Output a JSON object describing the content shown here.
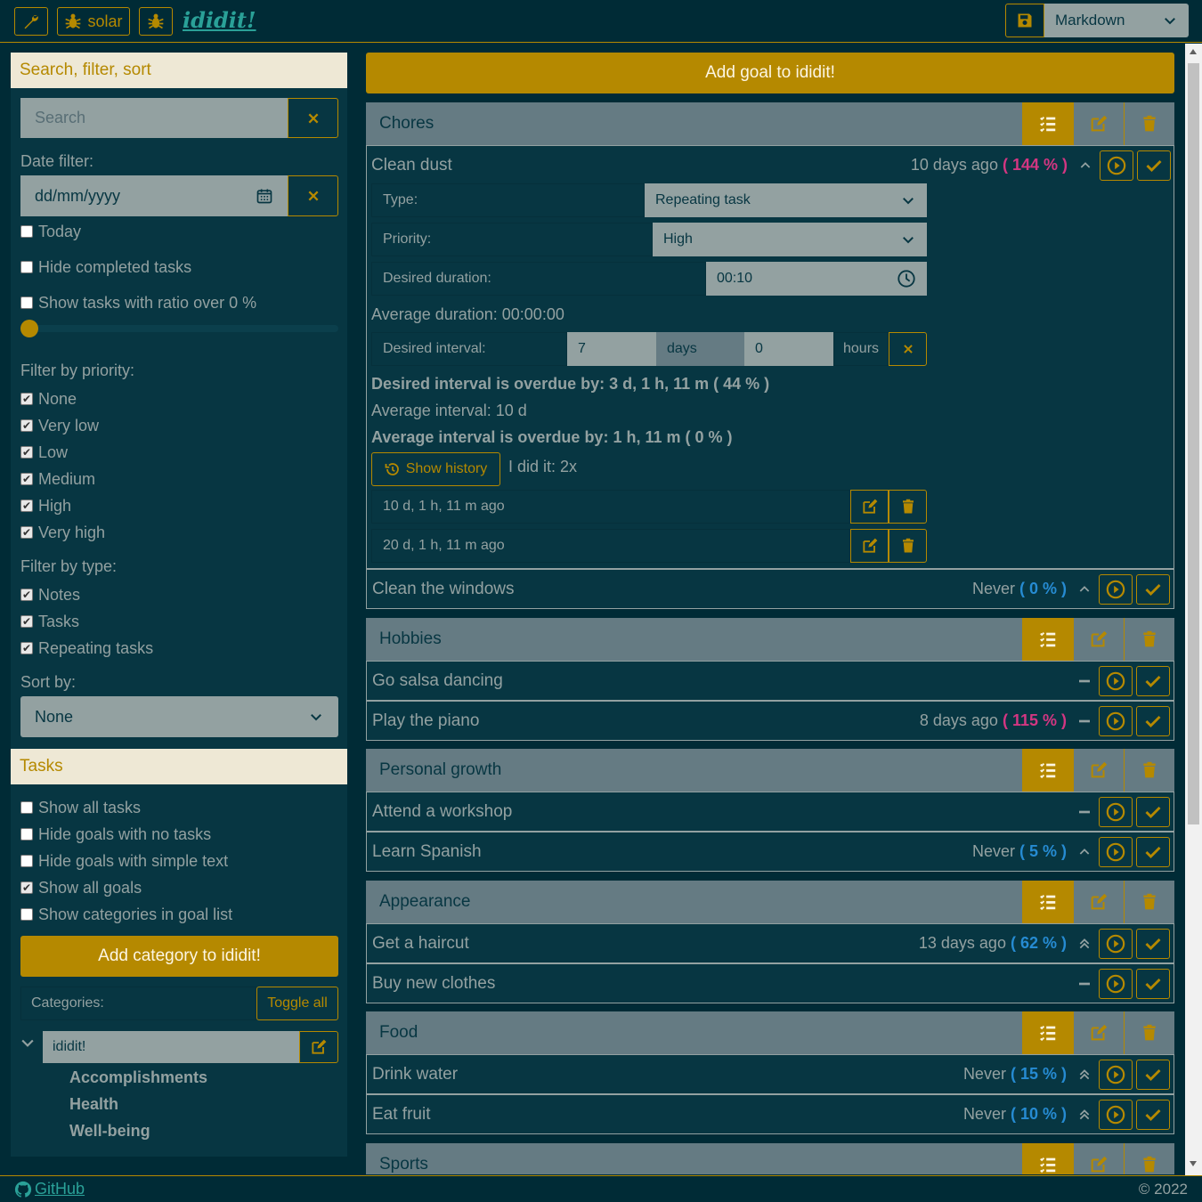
{
  "topbar": {
    "solar_label": "solar",
    "brand": "ididit!",
    "format_value": "Markdown"
  },
  "sidebar": {
    "search_header": "Search, filter, sort",
    "search_placeholder": "Search",
    "date_filter_label": "Date filter:",
    "date_placeholder": "dd/mm/yyyy",
    "today_label": "Today",
    "hide_completed_label": "Hide completed tasks",
    "ratio_label": "Show tasks with ratio over 0 %",
    "ratio_value": 0,
    "priority_label": "Filter by priority:",
    "priorities": [
      "None",
      "Very low",
      "Low",
      "Medium",
      "High",
      "Very high"
    ],
    "type_label": "Filter by type:",
    "types": [
      "Notes",
      "Tasks",
      "Repeating tasks"
    ],
    "sort_label": "Sort by:",
    "sort_value": "None",
    "tasks_header": "Tasks",
    "task_options": [
      {
        "label": "Show all tasks",
        "checked": false
      },
      {
        "label": "Hide goals with no tasks",
        "checked": false
      },
      {
        "label": "Hide goals with simple text",
        "checked": false
      },
      {
        "label": "Show all goals",
        "checked": true
      },
      {
        "label": "Show categories in goal list",
        "checked": false
      }
    ],
    "add_category_label": "Add category to ididit!",
    "categories_label": "Categories:",
    "toggle_all_label": "Toggle all",
    "root_category": "ididit!",
    "category_items": [
      "Accomplishments",
      "Health",
      "Well-being"
    ]
  },
  "main": {
    "add_goal_label": "Add goal to ididit!",
    "categories": [
      {
        "title": "Chores"
      },
      {
        "title": "Hobbies"
      },
      {
        "title": "Personal growth"
      },
      {
        "title": "Appearance"
      },
      {
        "title": "Food"
      },
      {
        "title": "Sports"
      }
    ],
    "goals": {
      "clean_dust": {
        "title": "Clean dust",
        "when": "10 days ago",
        "pct": "( 144 % )"
      },
      "clean_windows": {
        "title": "Clean the windows",
        "when": "Never",
        "pct": "( 0 % )"
      },
      "salsa": {
        "title": "Go salsa dancing"
      },
      "piano": {
        "title": "Play the piano",
        "when": "8 days ago",
        "pct": "( 115 % )"
      },
      "workshop": {
        "title": "Attend a workshop"
      },
      "spanish": {
        "title": "Learn Spanish",
        "when": "Never",
        "pct": "( 5 % )"
      },
      "haircut": {
        "title": "Get a haircut",
        "when": "13 days ago",
        "pct": "( 62 % )"
      },
      "clothes": {
        "title": "Buy new clothes"
      },
      "water": {
        "title": "Drink water",
        "when": "Never",
        "pct": "( 15 % )"
      },
      "fruit": {
        "title": "Eat fruit",
        "when": "Never",
        "pct": "( 10 % )"
      }
    },
    "detail": {
      "type_label": "Type:",
      "type_value": "Repeating task",
      "priority_label": "Priority:",
      "priority_value": "High",
      "duration_label": "Desired duration:",
      "duration_value": "00:10",
      "average_duration": "Average duration: 00:00:00",
      "interval_label": "Desired interval:",
      "interval_days": "7",
      "days_label": "days",
      "interval_hours": "0",
      "hours_label": "hours",
      "overdue_desired": "Desired interval is overdue by: 3 d, 1 h, 11 m ( 44 % )",
      "average_interval": "Average interval: 10 d",
      "overdue_average": "Average interval is overdue by: 1 h, 11 m ( 0 % )",
      "show_history_label": "Show history",
      "did_it": "I did it: 2x",
      "history": [
        "10 d, 1 h, 11 m ago",
        "20 d, 1 h, 11 m ago"
      ]
    }
  },
  "footer": {
    "github_label": "GitHub",
    "copyright": "© 2022"
  },
  "colors": {
    "background": "#002b36",
    "panel": "#073642",
    "accent": "#b58900",
    "category_header": "#657b83",
    "text": "#93a1a1",
    "percent_over": "#d33682",
    "percent_under": "#268bd2"
  }
}
